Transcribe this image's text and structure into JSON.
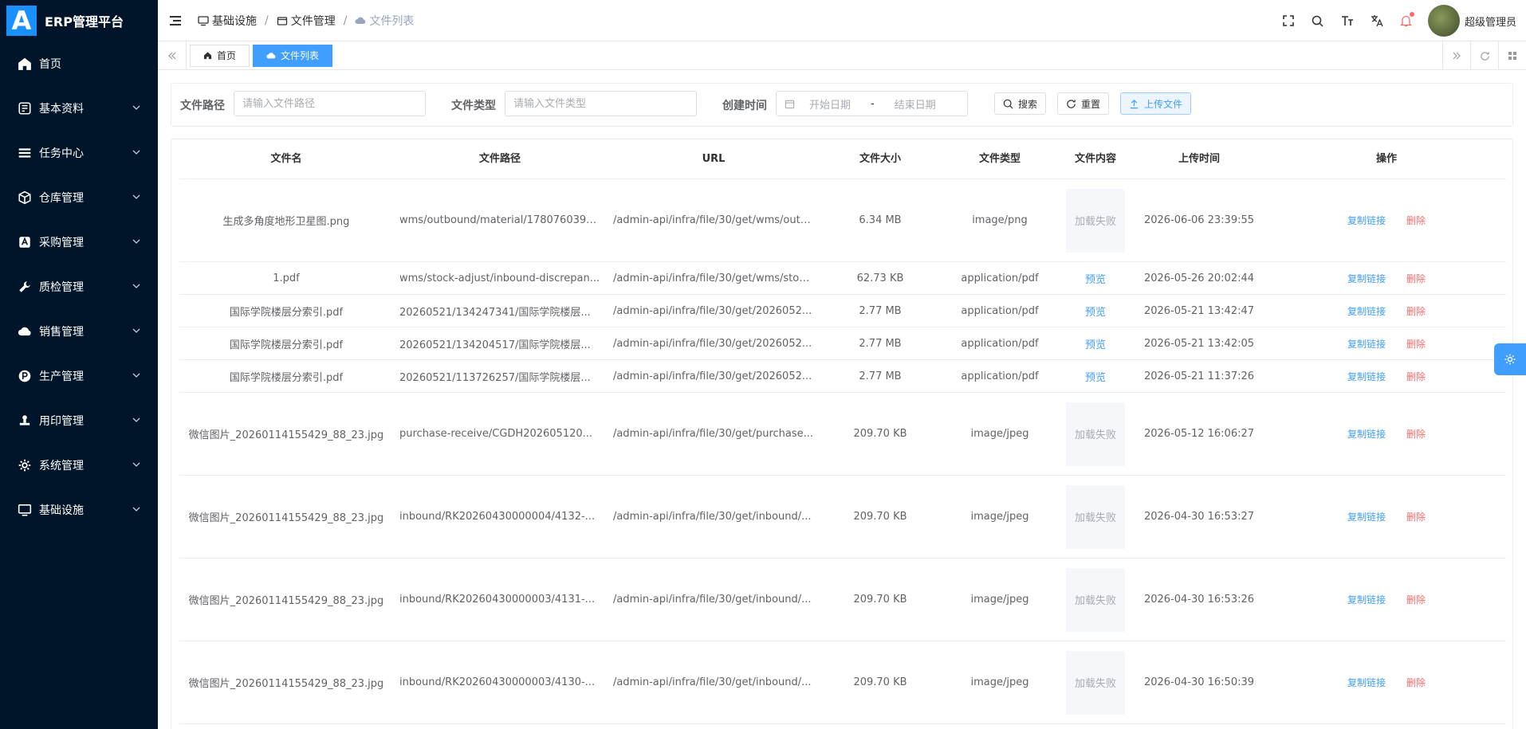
{
  "app": {
    "logo_letter": "A",
    "title": "ERP管理平台"
  },
  "sidebar": {
    "items": [
      {
        "label": "首页",
        "icon": "home-icon",
        "has_arrow": false
      },
      {
        "label": "基本资料",
        "icon": "info-icon",
        "has_arrow": true
      },
      {
        "label": "任务中心",
        "icon": "tasks-icon",
        "has_arrow": true
      },
      {
        "label": "仓库管理",
        "icon": "box-icon",
        "has_arrow": true
      },
      {
        "label": "采购管理",
        "icon": "purchase-icon",
        "has_arrow": true
      },
      {
        "label": "质检管理",
        "icon": "wrench-icon",
        "has_arrow": true
      },
      {
        "label": "销售管理",
        "icon": "cloud-icon",
        "has_arrow": true
      },
      {
        "label": "生产管理",
        "icon": "production-icon",
        "has_arrow": true
      },
      {
        "label": "用印管理",
        "icon": "stamp-icon",
        "has_arrow": true
      },
      {
        "label": "系统管理",
        "icon": "gear-icon",
        "has_arrow": true
      },
      {
        "label": "基础设施",
        "icon": "monitor-icon",
        "has_arrow": true
      }
    ]
  },
  "header": {
    "breadcrumb": [
      {
        "label": "基础设施",
        "icon": "monitor-icon"
      },
      {
        "label": "文件管理",
        "icon": "folder-icon"
      },
      {
        "label": "文件列表",
        "icon": "cloud-upload-icon"
      }
    ],
    "username": "超级管理员"
  },
  "tabs": [
    {
      "label": "首页",
      "icon": "home-icon",
      "active": false
    },
    {
      "label": "文件列表",
      "icon": "cloud-upload-icon",
      "active": true
    }
  ],
  "search": {
    "path_label": "文件路径",
    "path_placeholder": "请输入文件路径",
    "type_label": "文件类型",
    "type_placeholder": "请输入文件类型",
    "time_label": "创建时间",
    "start_placeholder": "开始日期",
    "range_sep": "-",
    "end_placeholder": "结束日期",
    "search_btn": "搜索",
    "reset_btn": "重置",
    "upload_btn": "上传文件"
  },
  "table": {
    "columns": [
      "文件名",
      "文件路径",
      "URL",
      "文件大小",
      "文件类型",
      "文件内容",
      "上传时间",
      "操作"
    ],
    "copy_label": "复制链接",
    "delete_label": "删除",
    "preview_label": "预览",
    "load_fail_label": "加载失败",
    "rows": [
      {
        "name": "生成多角度地形卫星图.png",
        "path": "wms/outbound/material/1780760390...",
        "url": "/admin-api/infra/file/30/get/wms/outb...",
        "size": "6.34 MB",
        "type": "image/png",
        "content": "image",
        "time": "2026-06-06 23:39:55"
      },
      {
        "name": "1.pdf",
        "path": "wms/stock-adjust/inbound-discrepan...",
        "url": "/admin-api/infra/file/30/get/wms/stoc...",
        "size": "62.73 KB",
        "type": "application/pdf",
        "content": "preview",
        "time": "2026-05-26 20:02:44"
      },
      {
        "name": "国际学院楼层分索引.pdf",
        "path": "20260521/134247341/国际学院楼层...",
        "url": "/admin-api/infra/file/30/get/2026052...",
        "size": "2.77 MB",
        "type": "application/pdf",
        "content": "preview",
        "time": "2026-05-21 13:42:47"
      },
      {
        "name": "国际学院楼层分索引.pdf",
        "path": "20260521/134204517/国际学院楼层...",
        "url": "/admin-api/infra/file/30/get/2026052...",
        "size": "2.77 MB",
        "type": "application/pdf",
        "content": "preview",
        "time": "2026-05-21 13:42:05"
      },
      {
        "name": "国际学院楼层分索引.pdf",
        "path": "20260521/113726257/国际学院楼层...",
        "url": "/admin-api/infra/file/30/get/2026052...",
        "size": "2.77 MB",
        "type": "application/pdf",
        "content": "preview",
        "time": "2026-05-21 11:37:26"
      },
      {
        "name": "微信图片_20260114155429_88_23.jpg",
        "path": "purchase-receive/CGDH202605120...",
        "url": "/admin-api/infra/file/30/get/purchase...",
        "size": "209.70 KB",
        "type": "image/jpeg",
        "content": "image",
        "time": "2026-05-12 16:06:27"
      },
      {
        "name": "微信图片_20260114155429_88_23.jpg",
        "path": "inbound/RK20260430000004/4132-...",
        "url": "/admin-api/infra/file/30/get/inbound/...",
        "size": "209.70 KB",
        "type": "image/jpeg",
        "content": "image",
        "time": "2026-04-30 16:53:27"
      },
      {
        "name": "微信图片_20260114155429_88_23.jpg",
        "path": "inbound/RK20260430000003/4131-...",
        "url": "/admin-api/infra/file/30/get/inbound/...",
        "size": "209.70 KB",
        "type": "image/jpeg",
        "content": "image",
        "time": "2026-04-30 16:53:26"
      },
      {
        "name": "微信图片_20260114155429_88_23.jpg",
        "path": "inbound/RK20260430000003/4130-...",
        "url": "/admin-api/infra/file/30/get/inbound/...",
        "size": "209.70 KB",
        "type": "image/jpeg",
        "content": "image",
        "time": "2026-04-30 16:50:39"
      }
    ]
  },
  "colors": {
    "sidebar_bg": "#001529",
    "primary": "#409eff",
    "danger": "#f56c6c"
  }
}
